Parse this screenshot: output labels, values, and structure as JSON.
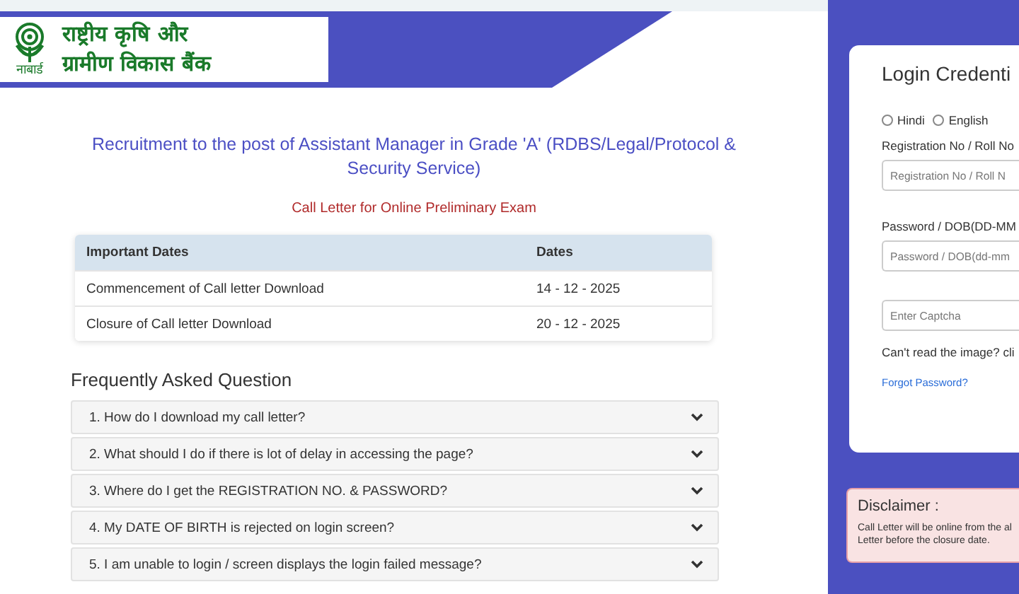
{
  "header": {
    "logo_caption": "नाबार्ड",
    "name_lines": [
      "राष्ट्रीय कृषि और",
      "ग्रामीण विकास बैंक"
    ]
  },
  "title": "Recruitment to the post of Assistant Manager in Grade 'A' (RDBS/Legal/Protocol & Security Service)",
  "subtitle": "Call Letter for Online Preliminary Exam",
  "dates_table": {
    "columns": [
      "Important Dates",
      "Dates"
    ],
    "rows": [
      {
        "event": "Commencement of Call letter Download",
        "date": "14 - 12 - 2025"
      },
      {
        "event": "Closure of Call letter Download",
        "date": "20 - 12 - 2025"
      }
    ]
  },
  "faq": {
    "heading": "Frequently Asked Question",
    "items": [
      {
        "question": "1. How do I download my call letter?",
        "expanded": false
      },
      {
        "question": "2. What should I do if there is lot of delay in accessing the page?",
        "expanded": false
      },
      {
        "question": "3. Where do I get the REGISTRATION NO. & PASSWORD?",
        "expanded": false
      },
      {
        "question": "4. My DATE OF BIRTH is rejected on login screen?",
        "expanded": false
      },
      {
        "question": "5. I am unable to login / screen displays the login failed message?",
        "expanded": false
      }
    ]
  },
  "login": {
    "title": "Login Credenti",
    "languages": [
      {
        "label": "Hindi",
        "selected": false
      },
      {
        "label": "English",
        "selected": false
      }
    ],
    "fields": [
      {
        "label": "Registration No / Roll No",
        "placeholder": "Registration No / Roll N"
      },
      {
        "label": "Password / DOB(DD-MM",
        "placeholder": "Password / DOB(dd-mm"
      },
      {
        "placeholder": "Enter Captcha"
      }
    ],
    "captcha_hint": "Can't read the image? cli",
    "forgot_link": "Forgot Password?"
  },
  "disclaimer": {
    "title": "Disclaimer :",
    "lines": [
      "Call Letter will be online from the al",
      "Letter before the closure date."
    ]
  }
}
